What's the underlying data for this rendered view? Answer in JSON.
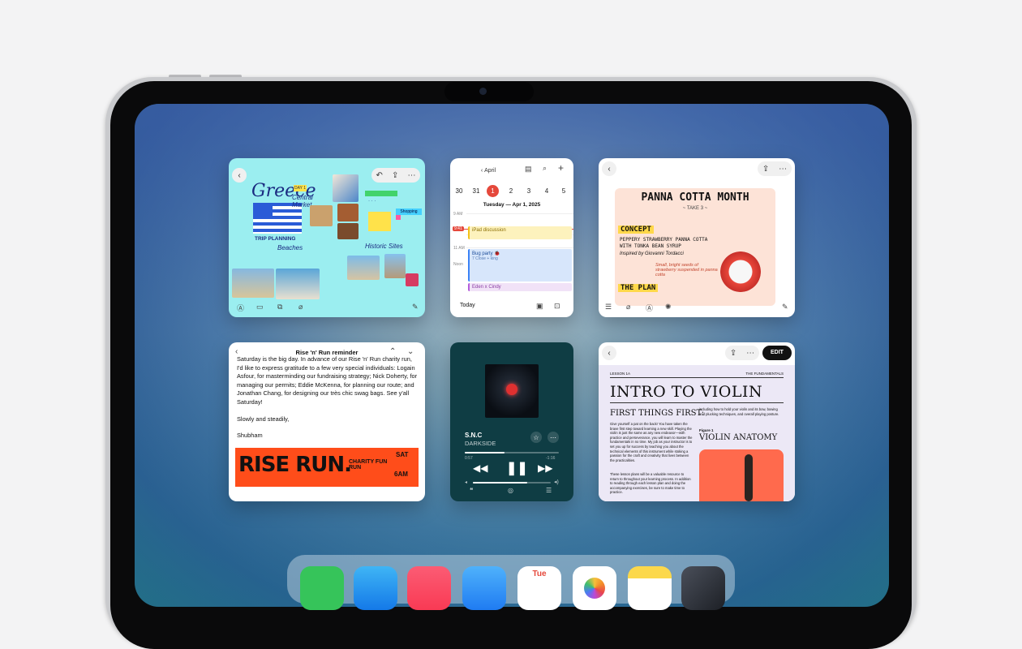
{
  "screen": {
    "accent": "#e5483b"
  },
  "freeform": {
    "title": "Greece",
    "subtitle": "TRIP PLANNING",
    "day1": "DAY 1",
    "day2": "DAY 2",
    "day3": "DAY 3",
    "central": "Central Market",
    "shopping": "Shopping",
    "beaches": "Beaches",
    "historic": "Historic Sites"
  },
  "calendar": {
    "month_label": "April",
    "days": [
      "30",
      "31",
      "1",
      "2",
      "3",
      "4",
      "5"
    ],
    "date_heading": "Tuesday — Apr 1, 2025",
    "hours": [
      "9 AM",
      "10 AM",
      "11 AM",
      "Noon"
    ],
    "events": [
      {
        "title": "iPad discussion"
      },
      {
        "title": "Bug party 🐞",
        "sub": "7 Close + king"
      },
      {
        "title": "Eden x Cindy"
      }
    ],
    "time_badge": "9:41",
    "today_label": "Today"
  },
  "notes": {
    "title": "PANNA COTTA MONTH",
    "subtitle": "~ TAKE 3 ~",
    "concept_label": "CONCEPT",
    "concept_text": "PEPPERY STRAWBERRY PANNA COTTA WITH TONKA BEAN SYRUP",
    "inspired": "Inspired by Giovanni Tordacci",
    "handnote": "Small, bright seeds of strawberry suspended in panna cotta",
    "plan_label": "THE PLAN"
  },
  "mail": {
    "subject": "Rise 'n' Run reminder",
    "paragraph": "Saturday is the big day. In advance of our Rise 'n' Run charity run, I'd like to express gratitude to a few very special individuals: Logain Asfour, for masterminding our fundraising strategy; Nick Doherty, for managing our permits; Eddie McKenna, for planning our route; and Jonathan Chang, for designing our très chic swag bags. See y'all Saturday!",
    "signoff": "Slowly and steadily,",
    "name": "Shubham",
    "banner_title": "RISE RUN.",
    "banner_sub": "CHARITY FUN RUN",
    "banner_day": "SAT",
    "banner_time": "6AM"
  },
  "music": {
    "track": "S.N.C",
    "artist": "DARKSIDE",
    "elapsed": "0:57",
    "remaining": "-1:16",
    "progress": 0.42,
    "volume": 0.7
  },
  "books": {
    "edit_label": "EDIT",
    "lesson": "LESSON 1A",
    "section": "THE FUNDAMENTALS",
    "title": "INTRO TO VIOLIN",
    "heading": "FIRST THINGS FIRST:",
    "col1": "Give yourself a pat on the back! You have taken the brave first step toward learning a new skill. Playing the violin is just the same as any new endeavor—with practice and perseverance, you will learn to master the fundamentals in no time. My job as your instructor is to set you up for success by teaching you about the technical elements of this instrument while stoking a passion for the craft and creativity that lives between the practicalities.",
    "col1b": "These lesson plans will be a valuable resource to return to throughout your learning process. In addition to reading through each lesson plan and doing the accompanying exercises, be sure to make time to practice.",
    "col2": "including how to hold your violin and its bow, bowing and plucking techniques, and overall playing posture.",
    "figure": "Figure 1",
    "anatomy": "VIOLIN ANATOMY"
  },
  "dock": {
    "calendar_day": "Tue"
  }
}
